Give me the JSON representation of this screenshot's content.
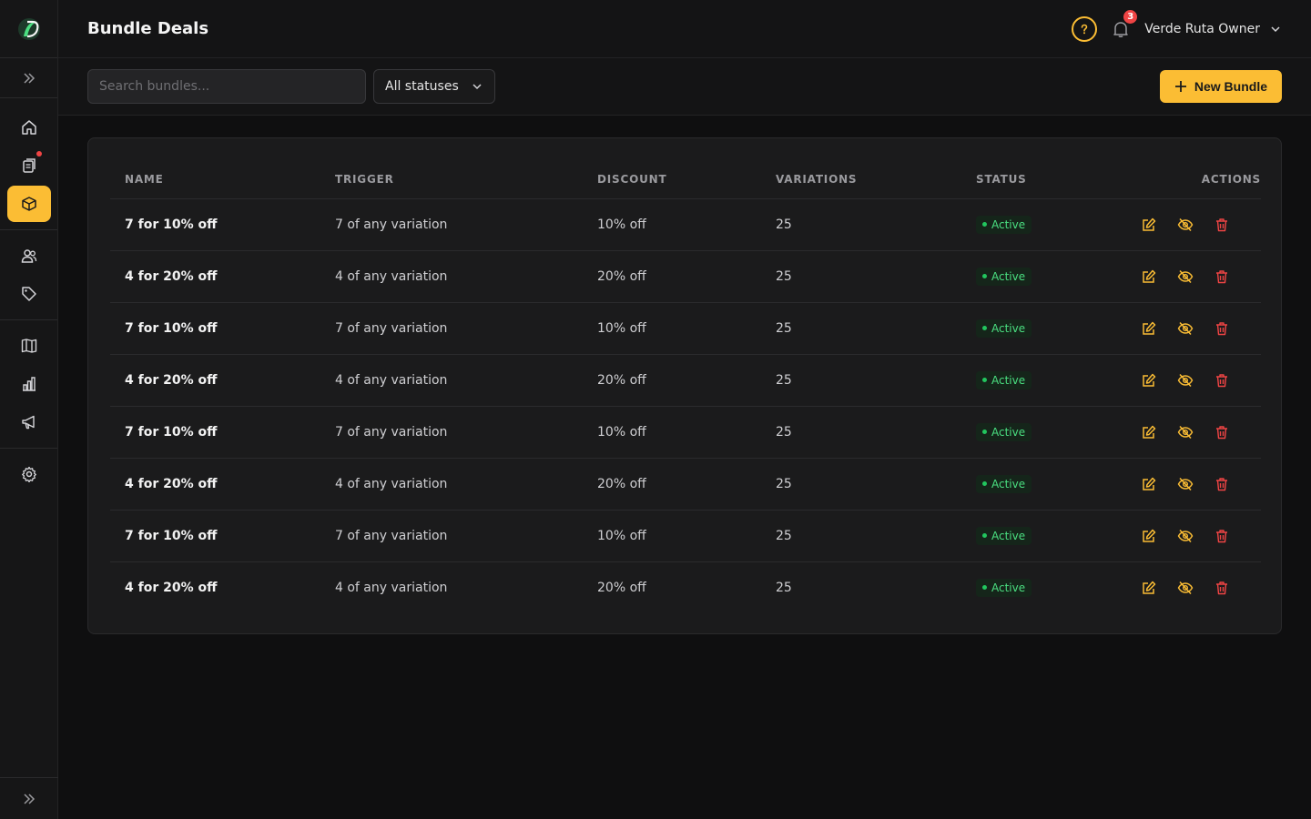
{
  "header": {
    "title": "Bundle Deals",
    "notification_count": "3",
    "user_name": "Verde Ruta Owner"
  },
  "toolbar": {
    "search_placeholder": "Search bundles...",
    "status_filter": "All statuses",
    "new_button_label": "New Bundle"
  },
  "sidebar": {
    "items": [
      {
        "name": "home-icon"
      },
      {
        "name": "clipboard-icon",
        "notification_dot": true
      },
      {
        "name": "box-icon",
        "active": true
      },
      {
        "name": "users-icon"
      },
      {
        "name": "tag-icon"
      },
      {
        "name": "book-icon"
      },
      {
        "name": "chart-icon"
      },
      {
        "name": "megaphone-icon"
      },
      {
        "name": "gear-icon"
      }
    ]
  },
  "table": {
    "columns": [
      "NAME",
      "TRIGGER",
      "DISCOUNT",
      "VARIATIONS",
      "STATUS",
      "ACTIONS"
    ],
    "rows": [
      {
        "name": "7 for 10% off",
        "trigger": "7 of any variation",
        "discount": "10% off",
        "variations": "25",
        "status": "Active"
      },
      {
        "name": "4 for 20% off",
        "trigger": "4 of any variation",
        "discount": "20% off",
        "variations": "25",
        "status": "Active"
      },
      {
        "name": "7 for 10% off",
        "trigger": "7 of any variation",
        "discount": "10% off",
        "variations": "25",
        "status": "Active"
      },
      {
        "name": "4 for 20% off",
        "trigger": "4 of any variation",
        "discount": "20% off",
        "variations": "25",
        "status": "Active"
      },
      {
        "name": "7 for 10% off",
        "trigger": "7 of any variation",
        "discount": "10% off",
        "variations": "25",
        "status": "Active"
      },
      {
        "name": "4 for 20% off",
        "trigger": "4 of any variation",
        "discount": "20% off",
        "variations": "25",
        "status": "Active"
      },
      {
        "name": "7 for 10% off",
        "trigger": "7 of any variation",
        "discount": "10% off",
        "variations": "25",
        "status": "Active"
      },
      {
        "name": "4 for 20% off",
        "trigger": "4 of any variation",
        "discount": "20% off",
        "variations": "25",
        "status": "Active"
      }
    ]
  },
  "colors": {
    "accent": "#fbbd34",
    "danger": "#ef4444",
    "success": "#22c55e"
  }
}
